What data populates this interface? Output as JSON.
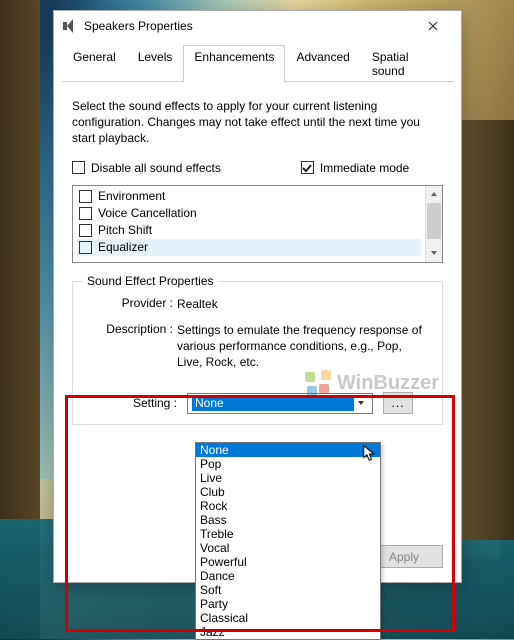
{
  "window": {
    "title": "Speakers Properties"
  },
  "tabs": {
    "general": "General",
    "levels": "Levels",
    "enhancements": "Enhancements",
    "advanced": "Advanced",
    "spatial": "Spatial sound"
  },
  "instructions": "Select the sound effects to apply for your current listening configuration. Changes may not take effect until the next time you start playback.",
  "options": {
    "disable_all": "Disable all sound effects",
    "immediate": "Immediate mode"
  },
  "effects": {
    "environment": "Environment",
    "voice_cancel": "Voice Cancellation",
    "pitch_shift": "Pitch Shift",
    "equalizer": "Equalizer"
  },
  "group": {
    "title": "Sound Effect Properties",
    "provider_label": "Provider :",
    "provider_value": "Realtek",
    "description_label": "Description :",
    "description_value": "Settings to emulate the frequency response of various performance conditions,  e.g., Pop, Live, Rock, etc."
  },
  "setting": {
    "label": "Setting :",
    "value": "None",
    "more": "...",
    "options": [
      "None",
      "Pop",
      "Live",
      "Club",
      "Rock",
      "Bass",
      "Treble",
      "Vocal",
      "Powerful",
      "Dance",
      "Soft",
      "Party",
      "Classical",
      "Jazz"
    ]
  },
  "buttons": {
    "apply": "Apply"
  },
  "watermark": "WinBuzzer"
}
